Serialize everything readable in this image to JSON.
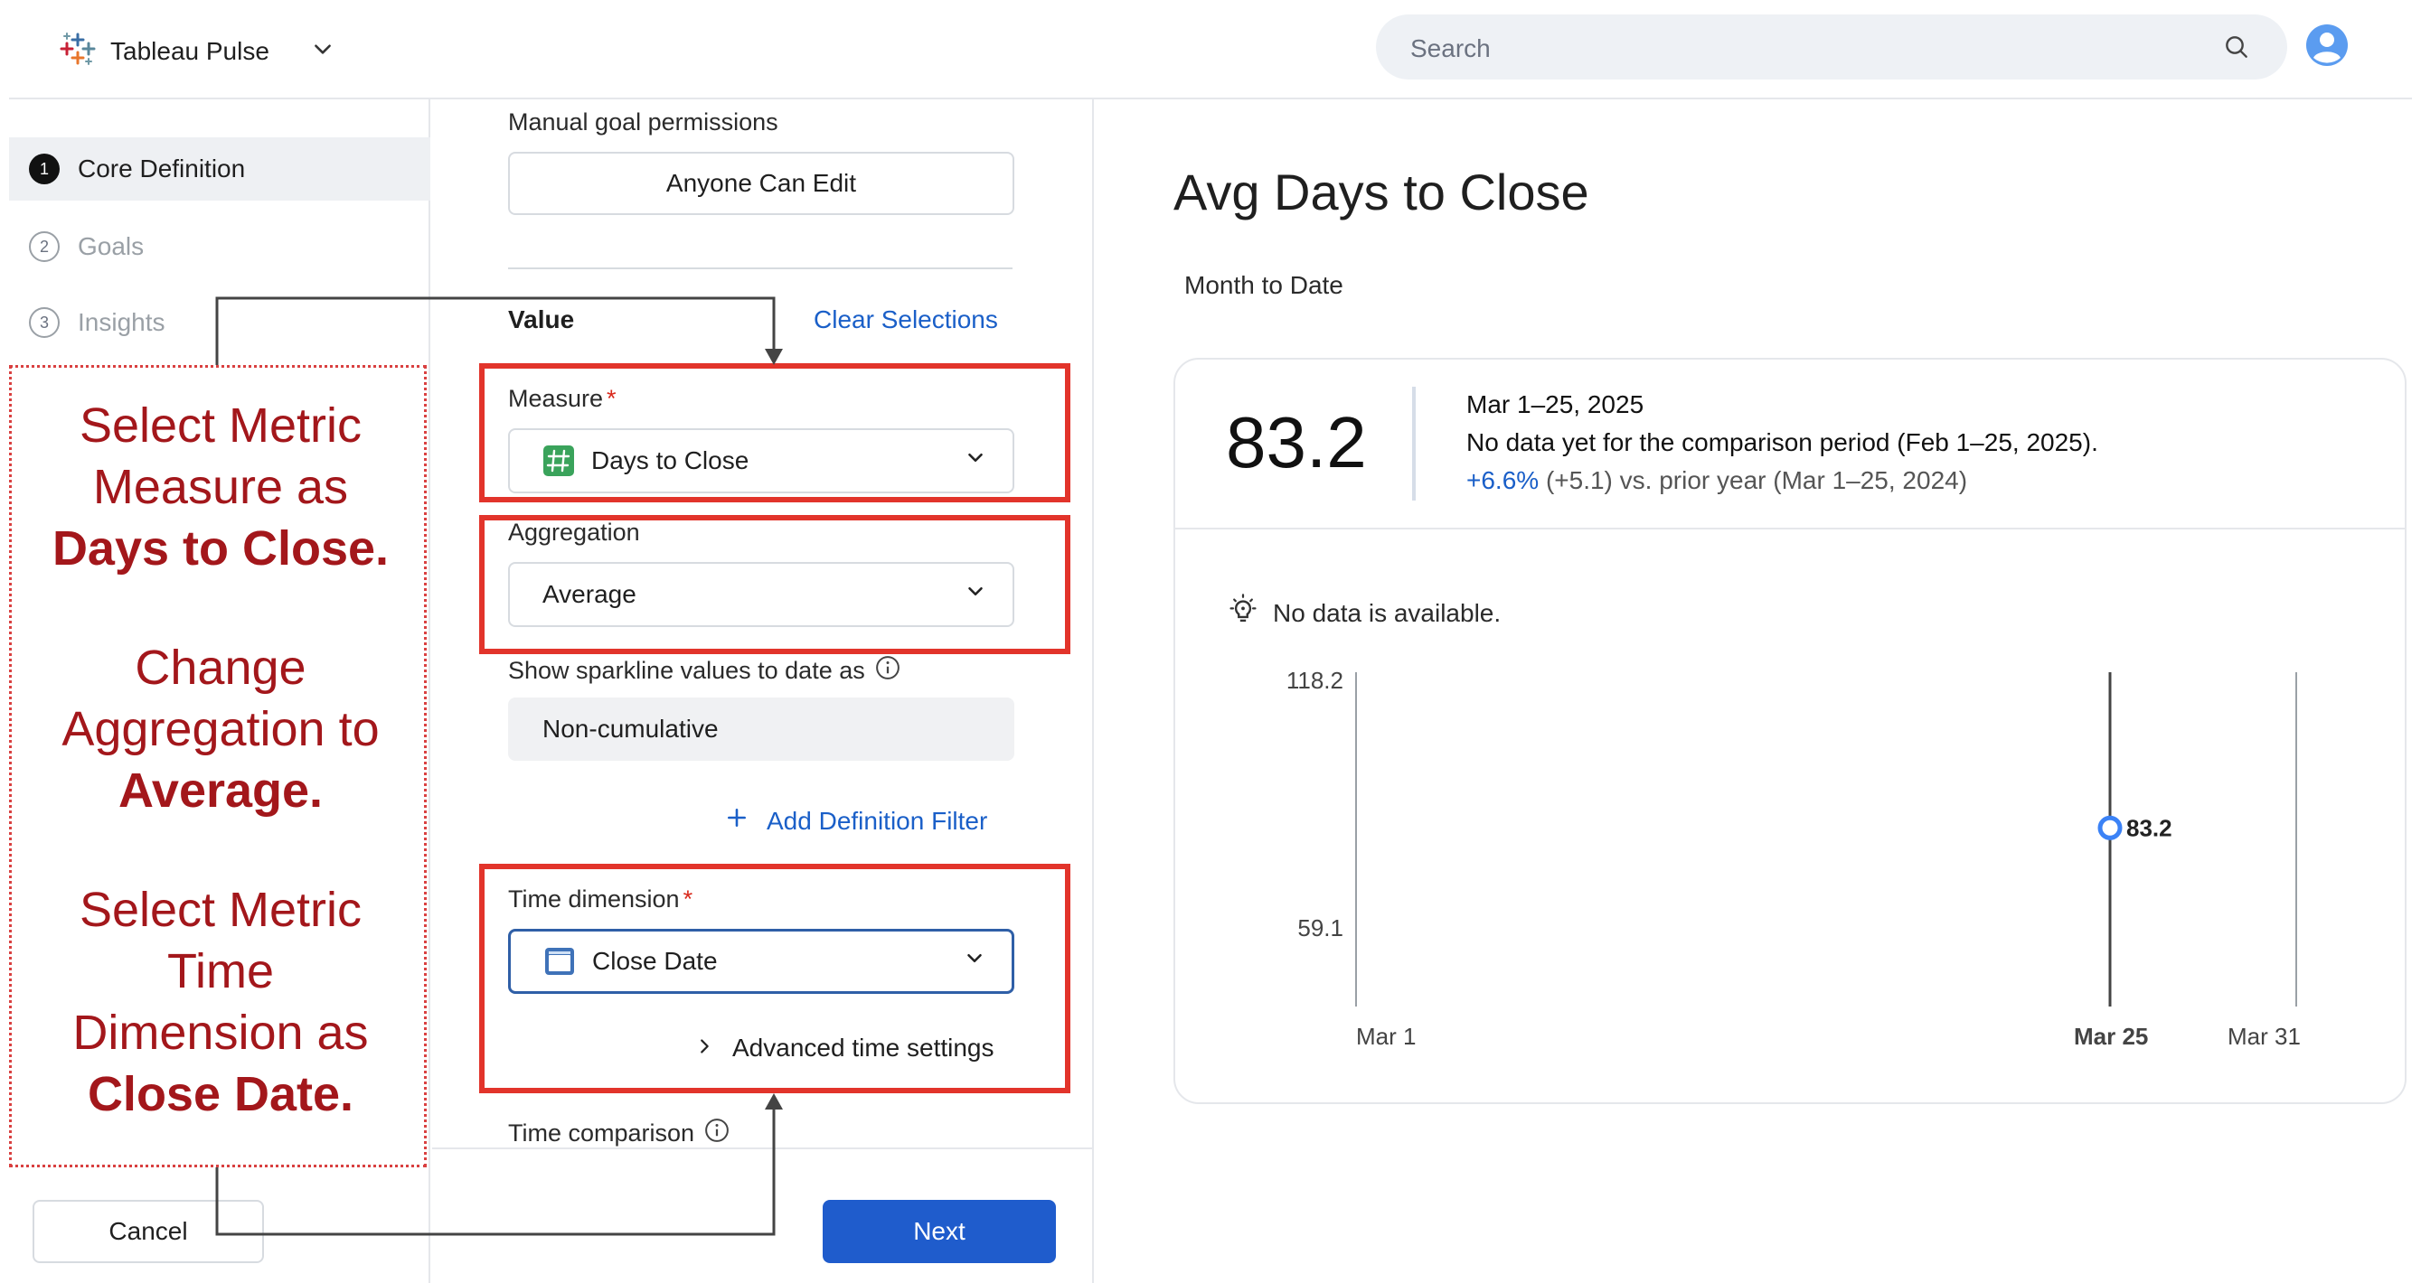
{
  "app": {
    "name": "Tableau Pulse",
    "search_placeholder": "Search"
  },
  "steps": [
    {
      "num": "1",
      "label": "Core Definition",
      "state": "active"
    },
    {
      "num": "2",
      "label": "Goals",
      "state": "inactive"
    },
    {
      "num": "3",
      "label": "Insights",
      "state": "inactive"
    }
  ],
  "form": {
    "goal_permissions_label": "Manual goal permissions",
    "goal_permissions_value": "Anyone Can Edit",
    "value_heading": "Value",
    "clear_selections": "Clear Selections",
    "measure_label": "Measure",
    "measure_required": "*",
    "measure_value": "Days to Close",
    "aggregation_label": "Aggregation",
    "aggregation_value": "Average",
    "sparkline_label": "Show sparkline values to date as",
    "sparkline_value": "Non-cumulative",
    "add_filter": "Add Definition Filter",
    "time_dimension_label": "Time dimension",
    "time_dimension_required": "*",
    "time_dimension_value": "Close Date",
    "advanced_time": "Advanced time settings",
    "time_comparison_label": "Time comparison"
  },
  "footer": {
    "cancel": "Cancel",
    "next": "Next"
  },
  "annotation": {
    "block1_line1": "Select Metric",
    "block1_line2": "Measure as",
    "block1_line3": "Days to Close.",
    "block2_line1": "Change",
    "block2_line2": "Aggregation to",
    "block2_line3": "Average.",
    "block3_line1": "Select Metric",
    "block3_line2": "Time",
    "block3_line3": "Dimension as",
    "block3_line4": "Close Date.",
    "color": "#a3171b"
  },
  "preview": {
    "title": "Avg Days to Close",
    "range_label": "Month to Date",
    "value": "83.2",
    "period": "Mar 1–25, 2025",
    "comparison_note": "No data yet for the comparison period (Feb 1–25, 2025).",
    "yoy_change": "+6.6%",
    "yoy_rest": "(+5.1) vs. prior year (Mar 1–25, 2024)",
    "no_data": "No data is available."
  },
  "chart_data": {
    "type": "scatter",
    "x_ticks": [
      "Mar 1",
      "Mar 25",
      "Mar 31"
    ],
    "y_ticks": [
      "118.2",
      "59.1"
    ],
    "points": [
      {
        "x": "Mar 25",
        "y": 83.2,
        "label": "83.2"
      }
    ],
    "ylim": [
      59.1,
      118.2
    ],
    "accent": "#3b82f6"
  },
  "colors": {
    "accent": "#1a5fc8",
    "highlight_border": "#e2342b",
    "primary_button": "#1f5ccc"
  }
}
